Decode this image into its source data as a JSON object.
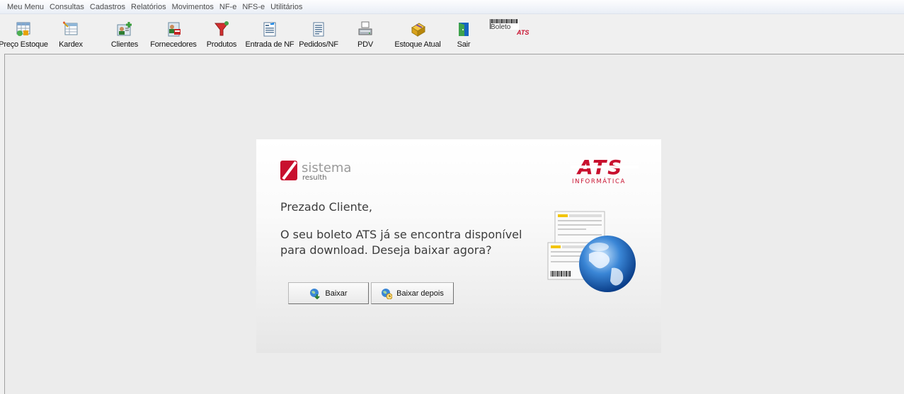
{
  "menu": [
    "Meu Menu",
    "Consultas",
    "Cadastros",
    "Relatórios",
    "Movimentos",
    "NF-e",
    "NFS-e",
    "Utilitários"
  ],
  "toolbar": {
    "items": [
      {
        "label": "Preço Estoque",
        "icon": "price-table-icon"
      },
      {
        "label": "Kardex",
        "icon": "kardex-table-icon"
      },
      {
        "label": "Clientes",
        "icon": "clients-icon"
      },
      {
        "label": "Fornecedores",
        "icon": "suppliers-icon"
      },
      {
        "label": "Produtos",
        "icon": "products-icon"
      },
      {
        "label": "Entrada de NF",
        "icon": "invoice-entry-icon"
      },
      {
        "label": "Pedidos/NF",
        "icon": "orders-icon"
      },
      {
        "label": "PDV",
        "icon": "pos-printer-icon"
      },
      {
        "label": "Estoque Atual",
        "icon": "stock-box-icon"
      },
      {
        "label": "Sair",
        "icon": "exit-door-icon"
      }
    ],
    "boleto_logo": {
      "text": "Boleto",
      "suffix": "ATS"
    }
  },
  "dialog": {
    "brand_left": {
      "main": "sistema",
      "sub": "resulth"
    },
    "brand_right": {
      "main": "ATS",
      "sub": "INFORMÁTICA"
    },
    "greeting": "Prezado Cliente,",
    "message": "O seu boleto ATS já se encontra disponível para download. Deseja baixar agora?",
    "buttons": {
      "download": "Baixar",
      "later": "Baixar depois"
    }
  },
  "colors": {
    "brand_red": "#c8102e",
    "brand_gray": "#9a9a9a",
    "menubar": "#e9eef6"
  }
}
